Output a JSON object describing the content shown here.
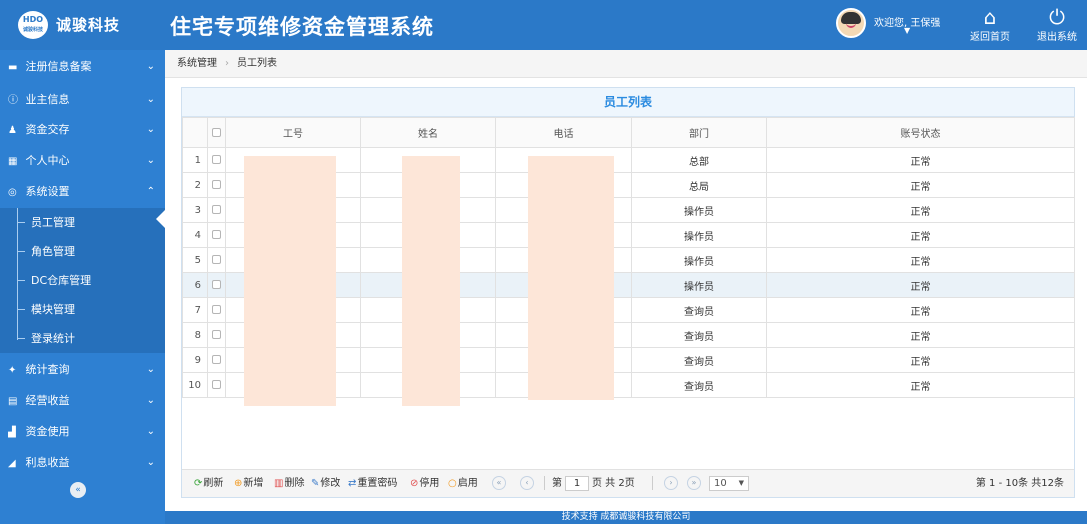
{
  "header": {
    "logo_text": "HDO",
    "logo_sub": "诚骏科技",
    "company": "诚骏科技",
    "system_title": "住宅专项维修资金管理系统",
    "welcome": "欢迎您, 王保强",
    "home_label": "返回首页",
    "exit_label": "退出系统"
  },
  "sidebar": {
    "items": [
      {
        "label": "注册信息备案",
        "icon": "▬",
        "chevron": "⌄"
      },
      {
        "label": "业主信息",
        "icon": "ⓘ",
        "chevron": "⌄"
      },
      {
        "label": "资金交存",
        "icon": "♟",
        "chevron": "⌄"
      },
      {
        "label": "个人中心",
        "icon": "▦",
        "chevron": "⌄"
      },
      {
        "label": "系统设置",
        "icon": "◎",
        "chevron": "⌃"
      },
      {
        "label": "统计查询",
        "icon": "✦",
        "chevron": "⌄"
      },
      {
        "label": "经营收益",
        "icon": "▤",
        "chevron": "⌄"
      },
      {
        "label": "资金使用",
        "icon": "▟",
        "chevron": "⌄"
      },
      {
        "label": "利息收益",
        "icon": "◢",
        "chevron": "⌄"
      }
    ],
    "sub_items": [
      {
        "label": "员工管理"
      },
      {
        "label": "角色管理"
      },
      {
        "label": "DC仓库管理"
      },
      {
        "label": "模块管理"
      },
      {
        "label": "登录统计"
      }
    ],
    "collapse_icon": "«"
  },
  "breadcrumb": {
    "items": [
      "系统管理",
      "员工列表"
    ],
    "separator": "›"
  },
  "panel": {
    "title": "员工列表",
    "columns": [
      "工号",
      "姓名",
      "电话",
      "部门",
      "账号状态"
    ],
    "rows": [
      {
        "no": "1",
        "id": "",
        "name": "",
        "phone": "",
        "dept": "总部",
        "status": "正常"
      },
      {
        "no": "2",
        "id": "",
        "name": "",
        "phone": "",
        "dept": "总局",
        "status": "正常"
      },
      {
        "no": "3",
        "id": "",
        "name": "",
        "phone": "",
        "dept": "操作员",
        "status": "正常"
      },
      {
        "no": "4",
        "id": "",
        "name": "",
        "phone": "",
        "dept": "操作员",
        "status": "正常"
      },
      {
        "no": "5",
        "id": "",
        "name": "",
        "phone": "",
        "dept": "操作员",
        "status": "正常"
      },
      {
        "no": "6",
        "id": "",
        "name": "",
        "phone": "",
        "dept": "操作员",
        "status": "正常"
      },
      {
        "no": "7",
        "id": "",
        "name": "",
        "phone": "",
        "dept": "查询员",
        "status": "正常"
      },
      {
        "no": "8",
        "id": "",
        "name": "",
        "phone": "",
        "dept": "查询员",
        "status": "正常"
      },
      {
        "no": "9",
        "id": "",
        "name": "",
        "phone": "",
        "dept": "查询员",
        "status": "正常"
      },
      {
        "no": "10",
        "id": "",
        "name": "",
        "phone": "",
        "dept": "查询员",
        "status": "正常"
      }
    ]
  },
  "toolbar": {
    "refresh": "刷新",
    "add": "新增",
    "delete": "删除",
    "edit": "修改",
    "reset_password": "重置密码",
    "disable": "停用",
    "enable": "启用"
  },
  "pager": {
    "page_prefix": "第",
    "current_page": "1",
    "page_suffix": "页 共 2页",
    "page_size": "10",
    "summary": "第 1 - 10条 共12条"
  },
  "footer": {
    "text": "技术支持 成都诚骏科技有限公司"
  },
  "colors": {
    "header_bg": "#2b79c8",
    "sidebar_bg": "#2e80d2",
    "accent": "#2b8be0",
    "redaction": "#fde6d8"
  }
}
